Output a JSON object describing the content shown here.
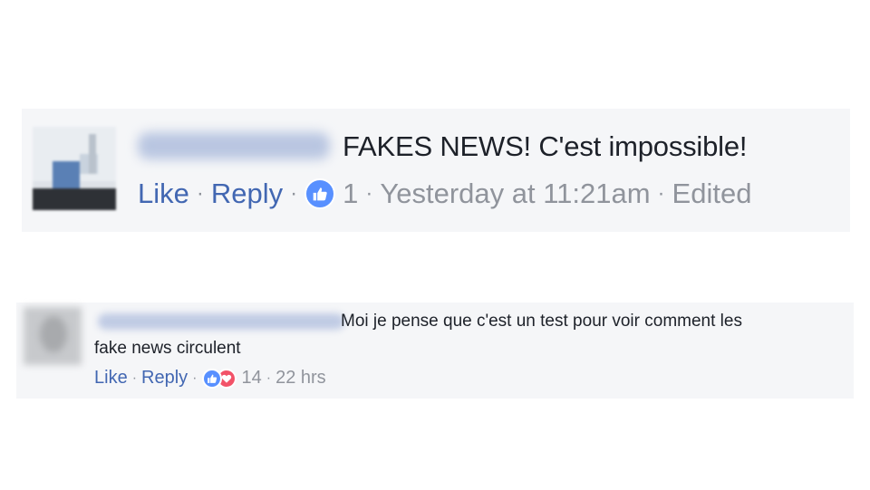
{
  "comments": [
    {
      "text": "FAKES NEWS! C'est impossible!",
      "actions": {
        "like_label": "Like",
        "reply_label": "Reply",
        "reaction_count": "1",
        "timestamp": "Yesterday at 11:21am",
        "edited_label": "Edited"
      },
      "reactions": [
        "like-icon"
      ]
    },
    {
      "text_line1": "Moi je pense que c'est un test pour voir comment les",
      "text_line2": "fake news circulent",
      "actions": {
        "like_label": "Like",
        "reply_label": "Reply",
        "reaction_count": "14",
        "timestamp": "22 hrs"
      },
      "reactions": [
        "like-icon",
        "love-icon"
      ]
    }
  ],
  "colors": {
    "link": "#4267b2",
    "meta": "#90949c",
    "text": "#1d2129",
    "comment_bg": "#f5f6f8",
    "like_blue": "#5890ff",
    "love_red": "#f25268"
  }
}
